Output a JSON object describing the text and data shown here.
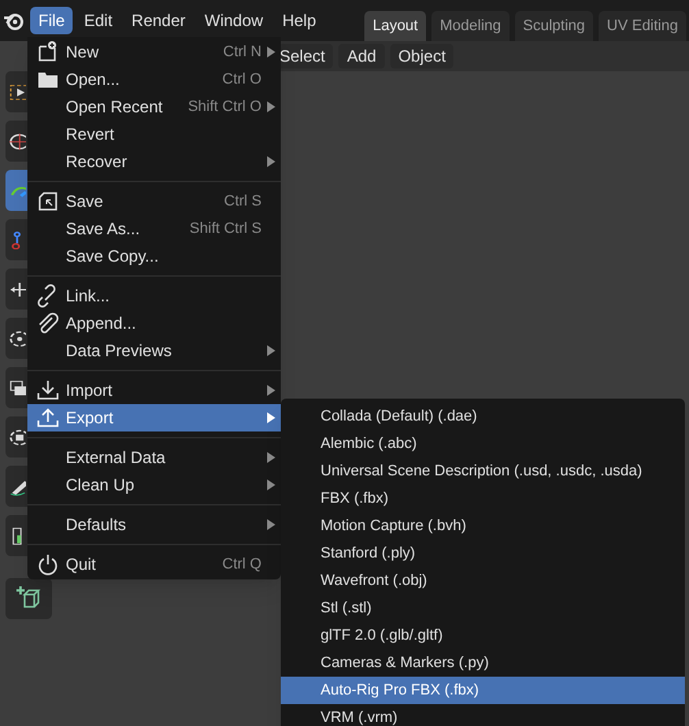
{
  "topbar": {
    "menus": [
      {
        "label": "File",
        "selected": true
      },
      {
        "label": "Edit",
        "selected": false
      },
      {
        "label": "Render",
        "selected": false
      },
      {
        "label": "Window",
        "selected": false
      },
      {
        "label": "Help",
        "selected": false
      }
    ],
    "workspaces": [
      {
        "label": "Layout",
        "selected": true
      },
      {
        "label": "Modeling",
        "selected": false
      },
      {
        "label": "Sculpting",
        "selected": false
      },
      {
        "label": "UV Editing",
        "selected": false
      }
    ]
  },
  "header": {
    "buttons": [
      "Select",
      "Add",
      "Object"
    ]
  },
  "toolbar": {
    "tools": [
      {
        "kind": "select",
        "selected": false
      },
      {
        "kind": "cursor",
        "selected": false
      },
      {
        "kind": "annotate",
        "selected": true
      },
      {
        "kind": "bone",
        "selected": false
      },
      {
        "kind": "move",
        "selected": false
      },
      {
        "kind": "rotate",
        "selected": false
      },
      {
        "kind": "scale",
        "selected": false
      },
      {
        "kind": "transform",
        "selected": false
      },
      {
        "kind": "pencil",
        "selected": false
      },
      {
        "kind": "measure",
        "selected": false
      },
      {
        "kind": "add-cube",
        "selected": false
      }
    ]
  },
  "file_menu": {
    "items": [
      {
        "kind": "item",
        "label": "New",
        "shortcut": "Ctrl N",
        "submenu": true,
        "selected": false
      },
      {
        "kind": "item",
        "label": "Open...",
        "shortcut": "Ctrl O",
        "submenu": false,
        "selected": false
      },
      {
        "kind": "item",
        "label": "Open Recent",
        "shortcut": "Shift Ctrl O",
        "submenu": true,
        "selected": false
      },
      {
        "kind": "item",
        "label": "Revert",
        "submenu": false,
        "selected": false
      },
      {
        "kind": "item",
        "label": "Recover",
        "submenu": true,
        "selected": false
      },
      {
        "kind": "separator"
      },
      {
        "kind": "item",
        "label": "Save",
        "shortcut": "Ctrl S",
        "submenu": false,
        "selected": false
      },
      {
        "kind": "item",
        "label": "Save As...",
        "shortcut": "Shift Ctrl S",
        "submenu": false,
        "selected": false
      },
      {
        "kind": "item",
        "label": "Save Copy...",
        "submenu": false,
        "selected": false
      },
      {
        "kind": "separator"
      },
      {
        "kind": "item",
        "label": "Link...",
        "submenu": false,
        "selected": false
      },
      {
        "kind": "item",
        "label": "Append...",
        "submenu": false,
        "selected": false
      },
      {
        "kind": "item",
        "label": "Data Previews",
        "submenu": true,
        "selected": false
      },
      {
        "kind": "separator"
      },
      {
        "kind": "item",
        "label": "Import",
        "submenu": true,
        "selected": false
      },
      {
        "kind": "item",
        "label": "Export",
        "submenu": true,
        "selected": true
      },
      {
        "kind": "separator"
      },
      {
        "kind": "item",
        "label": "External Data",
        "submenu": true,
        "selected": false
      },
      {
        "kind": "item",
        "label": "Clean Up",
        "submenu": true,
        "selected": false
      },
      {
        "kind": "separator"
      },
      {
        "kind": "item",
        "label": "Defaults",
        "submenu": true,
        "selected": false
      },
      {
        "kind": "separator"
      },
      {
        "kind": "item",
        "label": "Quit",
        "shortcut": "Ctrl Q",
        "submenu": false,
        "selected": false
      }
    ]
  },
  "export_menu": {
    "items": [
      {
        "label": "Collada (Default) (.dae)",
        "selected": false
      },
      {
        "label": "Alembic (.abc)",
        "selected": false
      },
      {
        "label": "Universal Scene Description (.usd, .usdc, .usda)",
        "selected": false
      },
      {
        "label": "FBX (.fbx)",
        "selected": false
      },
      {
        "label": "Motion Capture (.bvh)",
        "selected": false
      },
      {
        "label": "Stanford (.ply)",
        "selected": false
      },
      {
        "label": "Wavefront (.obj)",
        "selected": false
      },
      {
        "label": "Stl (.stl)",
        "selected": false
      },
      {
        "label": "glTF 2.0 (.glb/.gltf)",
        "selected": false
      },
      {
        "label": "Cameras & Markers (.py)",
        "selected": false
      },
      {
        "label": "Auto-Rig Pro FBX (.fbx)",
        "selected": true
      },
      {
        "label": "VRM (.vrm)",
        "selected": false
      }
    ]
  }
}
